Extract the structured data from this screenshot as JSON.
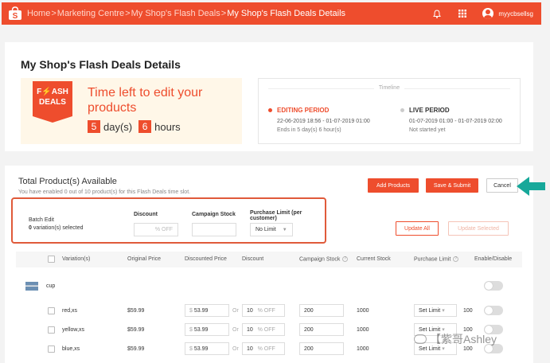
{
  "topbar": {
    "breadcrumbs": [
      "Home",
      "Marketing Centre",
      "My Shop's Flash Deals",
      "My Shop's Flash Deals Details"
    ],
    "separator": ">",
    "username": "myycbsellsg"
  },
  "details": {
    "title": "My Shop's Flash Deals Details",
    "badge_line1": "F⚡ASH",
    "badge_line2": "DEALS",
    "time_left_text": "Time left to edit your products",
    "days_value": "5",
    "days_label": "day(s)",
    "hours_value": "6",
    "hours_label": "hours",
    "timeline_title": "Timeline",
    "editing_period": {
      "title": "EDITING PERIOD",
      "dates": "22-06-2019 18:56 - 01-07-2019 01:00",
      "status": "Ends in 5 day(s) 6 hour(s)",
      "color": "#ee4d2d"
    },
    "live_period": {
      "title": "LIVE PERIOD",
      "dates": "01-07-2019 01:00 - 01-07-2019 02:00",
      "status": "Not started yet",
      "color": "#cccccc"
    }
  },
  "products": {
    "title": "Total Product(s) Available",
    "subtitle": "You have enabled 0 out of 10 product(s) for this Flash Deals time slot.",
    "add_products_label": "Add Products",
    "save_submit_label": "Save & Submit",
    "cancel_label": "Cancel"
  },
  "batch": {
    "title": "Batch Edit",
    "selected_count": "0",
    "selected_text": "variation(s) selected",
    "discount_header": "Discount",
    "discount_placeholder": "% OFF",
    "stock_header": "Campaign Stock",
    "limit_header": "Purchase Limit (per customer)",
    "limit_value": "No Limit",
    "update_all_label": "Update All",
    "update_selected_label": "Update Selected"
  },
  "table": {
    "headers": {
      "variations": "Variation(s)",
      "original_price": "Original Price",
      "discounted_price": "Discounted Price",
      "discount": "Discount",
      "campaign_stock": "Campaign Stock",
      "current_stock": "Current Stock",
      "purchase_limit": "Purchase Limit",
      "enable": "Enable/Disable"
    },
    "product_name": "cup",
    "currency": "$",
    "or_label": "Or",
    "off_label": "% OFF",
    "rows": [
      {
        "variation": "red,xs",
        "original_price": "$59.99",
        "discounted_price": "53.99",
        "discount": "10",
        "campaign_stock": "200",
        "current_stock": "1000",
        "limit_mode": "Set Limit",
        "limit_value": "100"
      },
      {
        "variation": "yellow,xs",
        "original_price": "$59.99",
        "discounted_price": "53.99",
        "discount": "10",
        "campaign_stock": "200",
        "current_stock": "1000",
        "limit_mode": "Set Limit",
        "limit_value": "100"
      },
      {
        "variation": "blue,xs",
        "original_price": "$59.99",
        "discounted_price": "53.99",
        "discount": "10",
        "campaign_stock": "200",
        "current_stock": "1000",
        "limit_mode": "Set Limit",
        "limit_value": "100"
      }
    ]
  },
  "watermark": "【紫哥Ashley"
}
